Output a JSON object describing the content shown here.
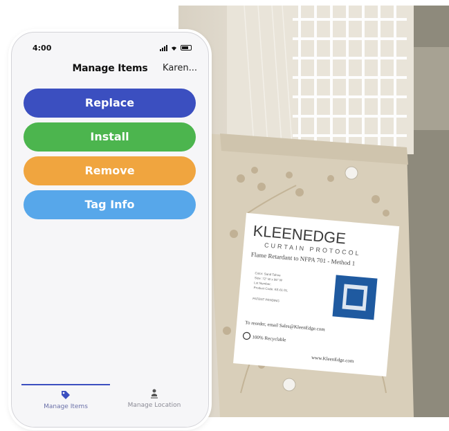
{
  "status_bar": {
    "time": "4:00"
  },
  "nav": {
    "title": "Manage Items",
    "user": "Karen..."
  },
  "actions": [
    {
      "label": "Replace",
      "color": "#3b4fc0"
    },
    {
      "label": "Install",
      "color": "#4cb54e"
    },
    {
      "label": "Remove",
      "color": "#f0a53f"
    },
    {
      "label": "Tag Info",
      "color": "#57a7ea"
    }
  ],
  "tabs": [
    {
      "label": "Manage Items",
      "icon": "tag-icon",
      "active": true
    },
    {
      "label": "Manage Location",
      "icon": "person-pin-icon",
      "active": false
    }
  ],
  "photo": {
    "brand_line1": "KLEENEDGE",
    "brand_line2": "CURTAIN PROTOCOL",
    "tagline": "Flame Retardant to NFPA 701 - Method 1",
    "reorder": "To reorder, email Sales@KleenEdge.com",
    "recyclable": "100% Recyclable",
    "website": "www.KleenEdge.com",
    "spec_1": "Color: Sand Tahoe",
    "spec_2": "Size: 72\" W x 96\" W",
    "spec_3": "Lot Number:",
    "spec_4": "Product Code: KE-61 DL",
    "patent": "PATENT PENDING"
  }
}
